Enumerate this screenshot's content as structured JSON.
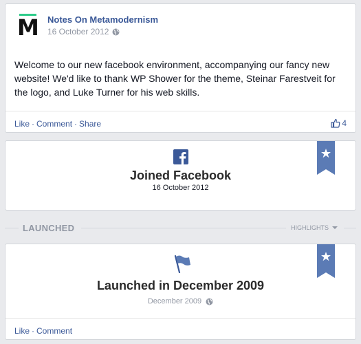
{
  "post": {
    "page_name": "Notes On Metamodernism",
    "date": "16 October 2012",
    "text": "Welcome to our new facebook environment, accompanying our fancy new website! We'd like to thank WP Shower for the theme, Steinar Farestveit for the logo, and Luke Turner for his web skills.",
    "avatar_letter": "M",
    "actions": {
      "like": "Like",
      "comment": "Comment",
      "share": "Share",
      "separator": "·"
    },
    "like_count": "4"
  },
  "joined": {
    "title": "Joined Facebook",
    "date": "16 October 2012"
  },
  "section": {
    "label": "LAUNCHED",
    "highlights": "HIGHLIGHTS"
  },
  "launched": {
    "title": "Launched in December 2009",
    "date": "December 2009",
    "actions": {
      "like": "Like",
      "comment": "Comment",
      "separator": "·"
    }
  },
  "colors": {
    "link": "#3b5998",
    "ribbon": "#5b7bb5",
    "avatar_accent": "#2ecc8a",
    "background": "#e9eaed"
  },
  "icons": {
    "privacy": "globe-icon",
    "like": "thumb-icon",
    "joined": "facebook-icon",
    "launched": "flag-icon",
    "ribbon": "star-ribbon-icon"
  }
}
